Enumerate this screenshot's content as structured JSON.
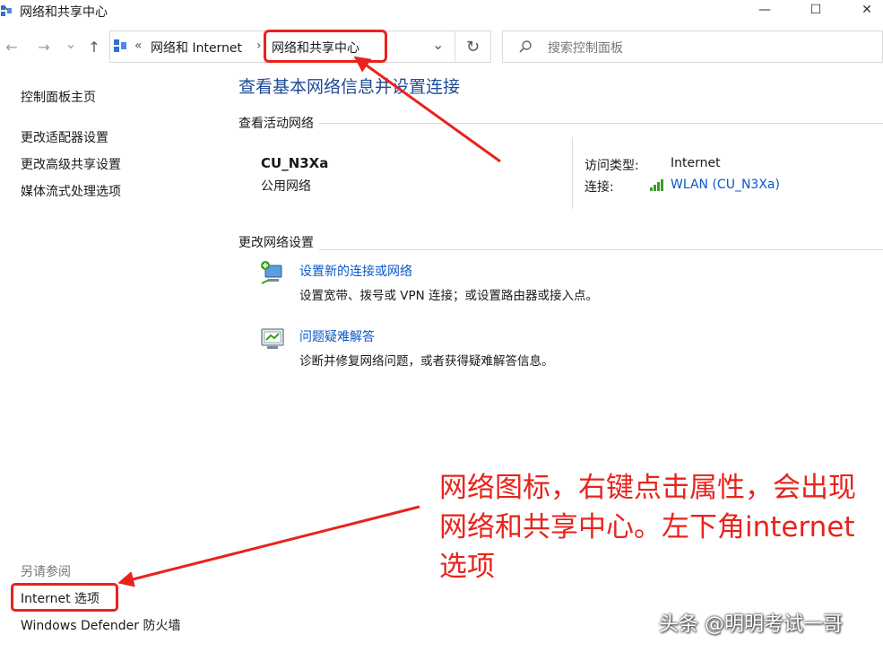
{
  "window": {
    "title": "网络和共享中心",
    "minimize_glyph": "—",
    "maximize_glyph": "☐",
    "close_glyph": "✕"
  },
  "address_bar": {
    "back_glyph": "←",
    "forward_glyph": "→",
    "recent_glyph": "⌄",
    "up_glyph": "↑",
    "overflow_glyph": "«",
    "crumb_1": "网络和 Internet",
    "separator": "›",
    "crumb_2": "网络和共享中心",
    "dropdown_glyph": "⌄",
    "refresh_glyph": "↻"
  },
  "search": {
    "placeholder": "搜索控制面板",
    "icon": "search-icon"
  },
  "sidebar": {
    "home": "控制面板主页",
    "items": [
      {
        "label": "更改适配器设置"
      },
      {
        "label": "更改高级共享设置"
      },
      {
        "label": "媒体流式处理选项"
      }
    ],
    "see_also_heading": "另请参阅",
    "see_also_items": [
      {
        "label": "Internet 选项"
      },
      {
        "label": "Windows Defender 防火墙"
      }
    ]
  },
  "main": {
    "title": "查看基本网络信息并设置连接",
    "active_networks_label": "查看活动网络",
    "network": {
      "name": "CU_N3Xa",
      "category": "公用网络",
      "access_type_label": "访问类型:",
      "access_type_value": "Internet",
      "connections_label": "连接:",
      "connection_value": "WLAN (CU_N3Xa)"
    },
    "change_settings_label": "更改网络设置",
    "tasks": [
      {
        "title": "设置新的连接或网络",
        "description": "设置宽带、拨号或 VPN 连接；或设置路由器或接入点。",
        "icon": "new-connection-icon"
      },
      {
        "title": "问题疑难解答",
        "description": "诊断并修复网络问题，或者获得疑难解答信息。",
        "icon": "troubleshoot-icon"
      }
    ]
  },
  "annotation": {
    "text": "网络图标，右键点击属性，会出现网络和共享中心。左下角internet选项",
    "color": "#e8231c"
  },
  "watermark": {
    "text": "头条 @明明考试一哥"
  },
  "colors": {
    "link": "#0b57c9",
    "title_blue": "#1f4b99",
    "annotation_red": "#e8231c",
    "signal_green": "#3a9d23"
  }
}
